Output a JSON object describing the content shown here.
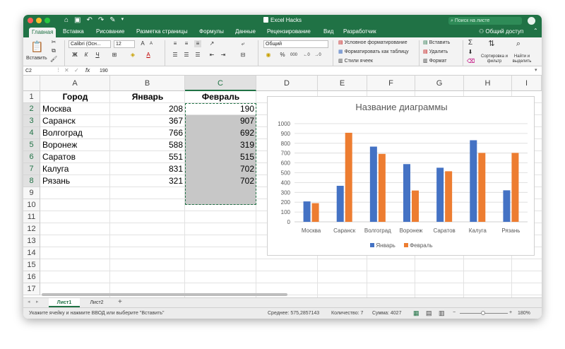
{
  "window": {
    "title": "Excel Hacks",
    "search_placeholder": "Поиск на листе",
    "share_label": "Общий доступ"
  },
  "colors": {
    "accent": "#207245",
    "series1": "#4472c4",
    "series2": "#ed7d31"
  },
  "tabs": [
    "Главная",
    "Вставка",
    "Рисование",
    "Разметка страницы",
    "Формулы",
    "Данные",
    "Рецензирование",
    "Вид",
    "Разработчик"
  ],
  "ribbon": {
    "paste_label": "Вставить",
    "font_name": "Calibri (Осн...",
    "font_size": "12",
    "number_format": "Общий",
    "styles": [
      "Условное форматирование",
      "Форматировать как таблицу",
      "Стили ячеек"
    ],
    "cells": [
      "Вставить",
      "Удалить",
      "Формат"
    ],
    "sort_label": "Сортировка и фильтр",
    "find_label": "Найти и выделить"
  },
  "formula_bar": {
    "name_box": "C2",
    "fx": "fx",
    "value": "190"
  },
  "columns": [
    "A",
    "B",
    "C",
    "D",
    "E",
    "F",
    "G",
    "H",
    "I"
  ],
  "rows": [
    "1",
    "2",
    "3",
    "4",
    "5",
    "6",
    "7",
    "8",
    "9",
    "10",
    "11",
    "12",
    "13",
    "14",
    "15",
    "16",
    "17"
  ],
  "table": {
    "headers": [
      "Город",
      "Январь",
      "Февраль"
    ],
    "data": [
      [
        "Москва",
        "208",
        "190"
      ],
      [
        "Саранск",
        "367",
        "907"
      ],
      [
        "Волгоград",
        "766",
        "692"
      ],
      [
        "Воронеж",
        "588",
        "319"
      ],
      [
        "Саратов",
        "551",
        "515"
      ],
      [
        "Калуга",
        "831",
        "702"
      ],
      [
        "Рязань",
        "321",
        "702"
      ]
    ]
  },
  "chart_data": {
    "type": "bar",
    "title": "Название диаграммы",
    "categories": [
      "Москва",
      "Саранск",
      "Волгоград",
      "Воронеж",
      "Саратов",
      "Калуга",
      "Рязань"
    ],
    "series": [
      {
        "name": "Январь",
        "values": [
          208,
          367,
          766,
          588,
          551,
          831,
          321
        ],
        "color": "#4472c4"
      },
      {
        "name": "Февраль",
        "values": [
          190,
          907,
          692,
          319,
          515,
          702,
          702
        ],
        "color": "#ed7d31"
      }
    ],
    "ylim": [
      0,
      1000
    ],
    "yticks": [
      "0",
      "100",
      "200",
      "300",
      "400",
      "500",
      "600",
      "700",
      "800",
      "900",
      "1000"
    ],
    "grid": true,
    "legend": "bottom"
  },
  "sheets": [
    "Лист1",
    "Лист2"
  ],
  "status": {
    "hint": "Укажите ячейку и нажмите ВВОД или выберите \"Вставить\"",
    "average": "Среднее: 575,2857143",
    "count": "Количество: 7",
    "sum": "Сумма: 4027",
    "zoom": "180%"
  }
}
